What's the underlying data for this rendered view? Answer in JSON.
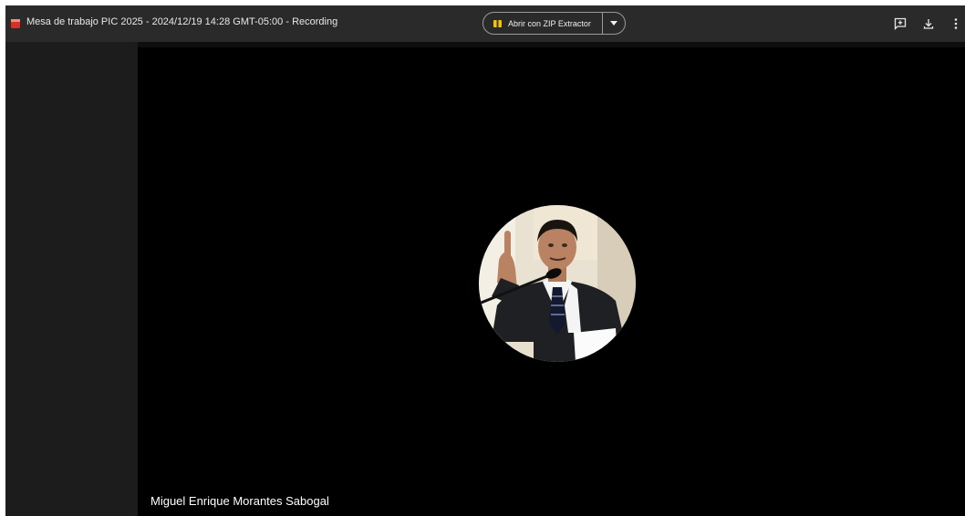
{
  "header": {
    "file_icon": "file-icon",
    "title": "Mesa de trabajo PIC 2025 - 2024/12/19 14:28 GMT-05:00 - Recording",
    "open_with": {
      "label": "Abrir con ZIP Extractor",
      "icon": "zip-extractor-icon",
      "dropdown_icon": "caret-down-icon"
    },
    "actions": [
      {
        "name": "add-comment",
        "icon": "add-comment-icon"
      },
      {
        "name": "download",
        "icon": "download-icon"
      },
      {
        "name": "more-options",
        "icon": "more-vert-icon"
      }
    ]
  },
  "video": {
    "participant_name": "Miguel Enrique Morantes Sabogal",
    "avatar_icon": "participant-avatar"
  },
  "colors": {
    "topbar": "#2a2a2a",
    "video_bg": "#000000",
    "side_panel": "#1c1c1c",
    "file_icon_red": "#d93025",
    "zip_icon_yellow": "#f4c20d"
  }
}
